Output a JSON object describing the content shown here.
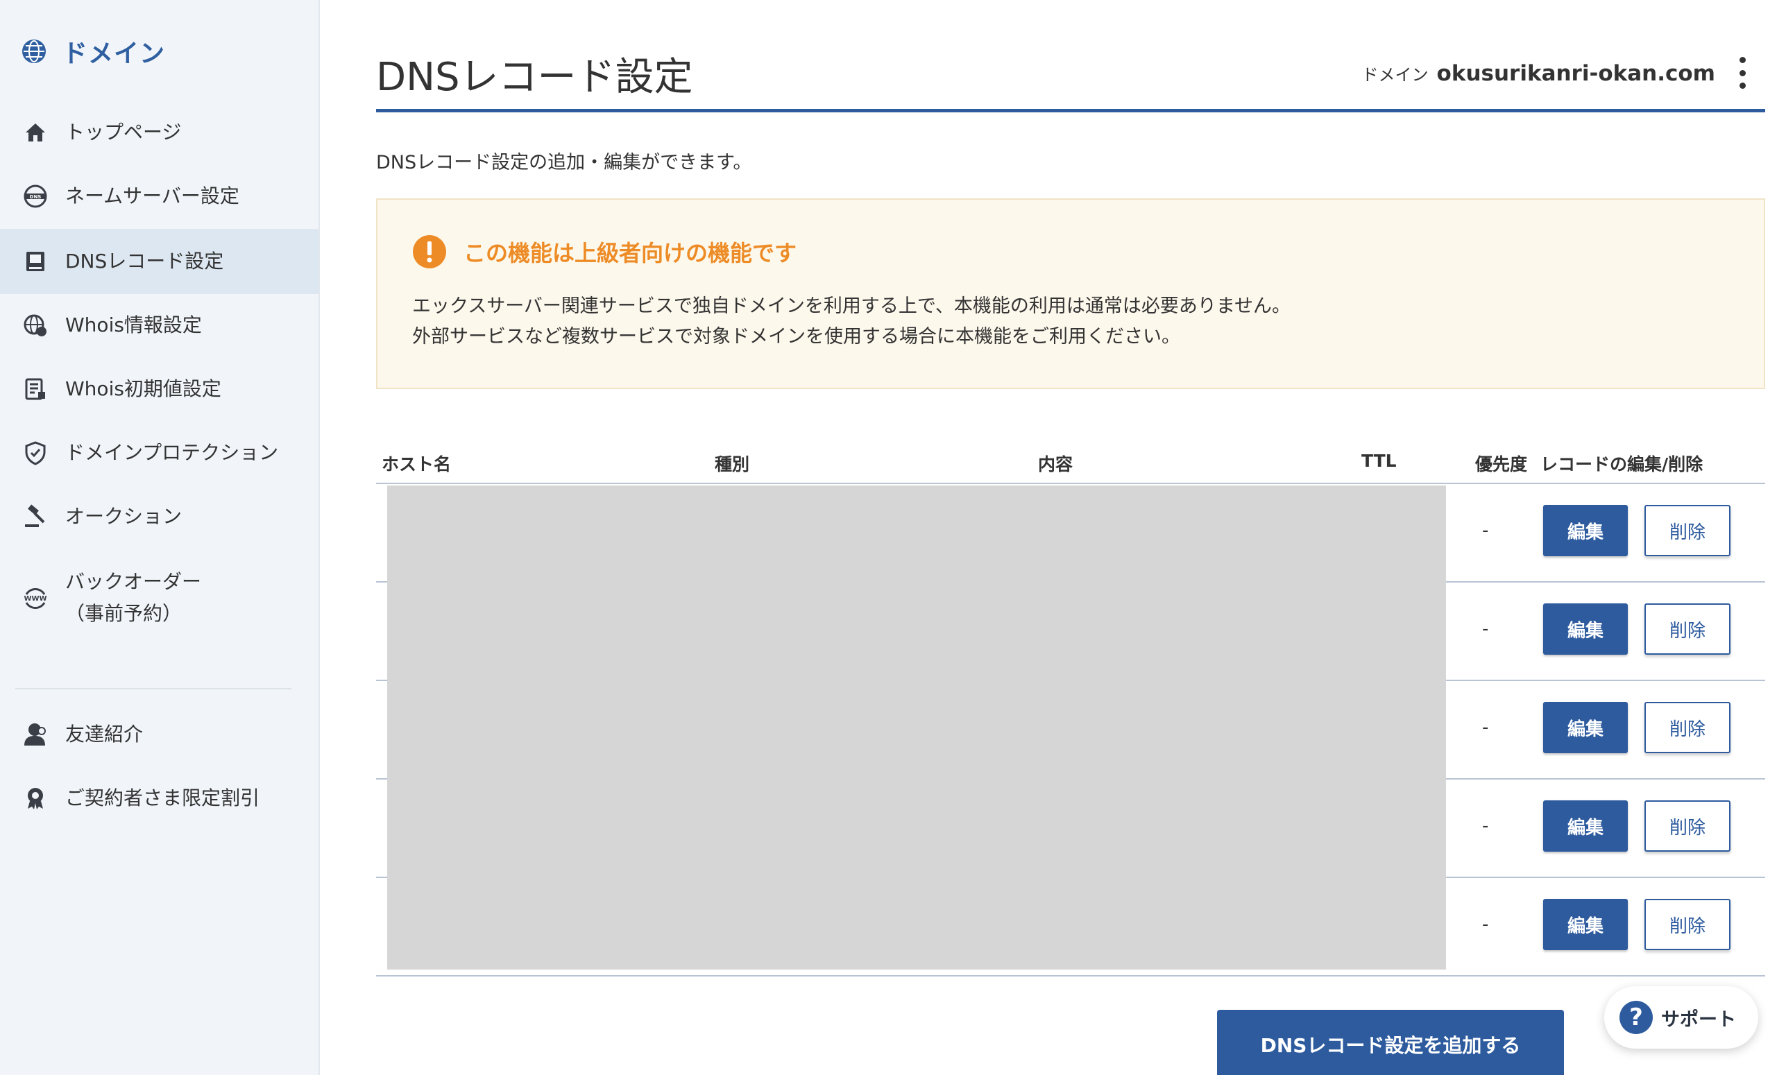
{
  "sidebar": {
    "brand": "ドメイン",
    "items": [
      {
        "label": "トップページ",
        "icon": "home-icon"
      },
      {
        "label": "ネームサーバー設定",
        "icon": "dns-server-icon"
      },
      {
        "label": "DNSレコード設定",
        "icon": "dns-record-icon",
        "active": true
      },
      {
        "label": "Whois情報設定",
        "icon": "whois-globe-icon"
      },
      {
        "label": "Whois初期値設定",
        "icon": "whois-document-icon"
      },
      {
        "label": "ドメインプロテクション",
        "icon": "shield-icon"
      },
      {
        "label": "オークション",
        "icon": "gavel-icon"
      },
      {
        "label": "バックオーダー\n（事前予約）",
        "icon": "www-icon"
      }
    ],
    "extra_items": [
      {
        "label": "友達紹介",
        "icon": "friend-icon"
      },
      {
        "label": "ご契約者さま限定割引",
        "icon": "badge-icon"
      }
    ]
  },
  "header": {
    "title": "DNSレコード設定",
    "domain_label": "ドメイン",
    "domain_value": "okusurikanri-okan.com"
  },
  "description": "DNSレコード設定の追加・編集ができます。",
  "notice": {
    "title": "この機能は上級者向けの機能です",
    "line1": "エックスサーバー関連サービスで独自ドメインを利用する上で、本機能の利用は通常は必要ありません。",
    "line2": "外部サービスなど複数サービスで対象ドメインを使用する場合に本機能をご利用ください。"
  },
  "table": {
    "columns": {
      "host": "ホスト名",
      "type": "種別",
      "content": "内容",
      "ttl": "TTL",
      "priority": "優先度",
      "actions": "レコードの編集/削除"
    },
    "rows": [
      {
        "priority": "-",
        "edit_label": "編集",
        "delete_label": "削除"
      },
      {
        "priority": "-",
        "edit_label": "編集",
        "delete_label": "削除"
      },
      {
        "priority": "-",
        "edit_label": "編集",
        "delete_label": "削除"
      },
      {
        "priority": "-",
        "edit_label": "編集",
        "delete_label": "削除"
      },
      {
        "priority": "-",
        "edit_label": "編集",
        "delete_label": "削除"
      }
    ]
  },
  "add_button": "DNSレコード設定を追加する",
  "support": {
    "label": "サポート",
    "icon_glyph": "?"
  },
  "colors": {
    "accent": "#2d5b9e",
    "sidebar_bg": "#f1f5fa",
    "notice_bg": "#fdf8ec",
    "warning": "#ed8c27"
  }
}
